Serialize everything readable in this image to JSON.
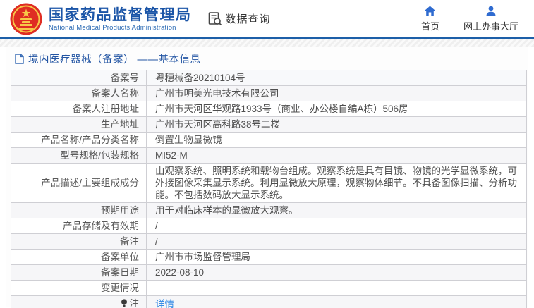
{
  "header": {
    "logo": {
      "title_cn": "国家药品监督管理局",
      "title_en": "National Medical Products Administration"
    },
    "data_query_label": "数据查询",
    "nav": [
      {
        "id": "home",
        "label": "首页",
        "icon": "home-icon"
      },
      {
        "id": "online-service-hall",
        "label": "网上办事大厅",
        "icon": "person-icon"
      }
    ]
  },
  "page": {
    "title": "境内医疗器械（备案） ——基本信息"
  },
  "table": {
    "rows": [
      {
        "label": "备案号",
        "value": "粤穗械备20210104号"
      },
      {
        "label": "备案人名称",
        "value": "广州市明美光电技术有限公司"
      },
      {
        "label": "备案人注册地址",
        "value": "广州市天河区华观路1933号（商业、办公楼自编A栋）506房"
      },
      {
        "label": "生产地址",
        "value": "广州市天河区高科路38号二楼"
      },
      {
        "label": "产品名称/产品分类名称",
        "value": "倒置生物显微镜"
      },
      {
        "label": "型号规格/包装规格",
        "value": "MI52-M"
      },
      {
        "label": "产品描述/主要组成成分",
        "value": "由观察系统、照明系统和载物台组成。观察系统是具有目镜、物镜的光学显微系统，可外接图像采集显示系统。利用显微放大原理，观察物体细节。不具备图像扫描、分析功能。不包括数码放大显示系统。"
      },
      {
        "label": "预期用途",
        "value": "用于对临床样本的显微放大观察。"
      },
      {
        "label": "产品存储及有效期",
        "value": "/"
      },
      {
        "label": "备注",
        "value": "/"
      },
      {
        "label": "备案单位",
        "value": "广州市市场监督管理局"
      },
      {
        "label": "备案日期",
        "value": "2022-08-10"
      },
      {
        "label": "变更情况",
        "value": ""
      },
      {
        "label": "注",
        "value": "详情",
        "link": true,
        "icon": "bulb-icon"
      }
    ]
  },
  "colors": {
    "header_blue": "#1d5fa8",
    "logo_blue": "#1b55a7",
    "title_blue": "#2355a3",
    "link_blue": "#3a8ee6",
    "emblem_red": "#df2d23",
    "emblem_gold": "#f7c948",
    "row_stripe": "#f6f6f8"
  }
}
